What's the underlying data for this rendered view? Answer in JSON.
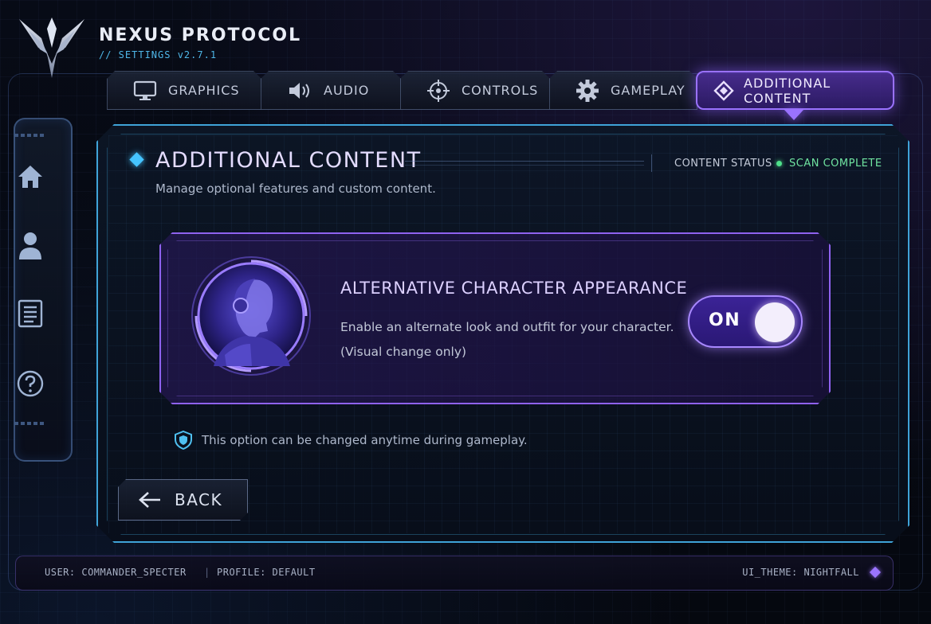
{
  "header": {
    "title": "NEXUS PROTOCOL",
    "subtitle": "// SETTINGS v2.7.1"
  },
  "tabs": [
    {
      "label": "GRAPHICS",
      "icon": "monitor-icon",
      "active": false
    },
    {
      "label": "AUDIO",
      "icon": "speaker-icon",
      "active": false
    },
    {
      "label": "CONTROLS",
      "icon": "crosshair-icon",
      "active": false
    },
    {
      "label": "GAMEPLAY",
      "icon": "gear-icon",
      "active": false
    },
    {
      "label": "ADDITIONAL CONTENT",
      "icon": "diamond-icon",
      "active": true
    }
  ],
  "sidebar": {
    "items": [
      {
        "icon": "home-icon"
      },
      {
        "icon": "user-icon"
      },
      {
        "icon": "list-icon"
      },
      {
        "icon": "help-icon"
      }
    ]
  },
  "section": {
    "title": "ADDITIONAL CONTENT",
    "description": "Manage optional features and custom content.",
    "status_label": "CONTENT STATUS",
    "status_value": "SCAN COMPLETE",
    "status_color": "#4ee08a"
  },
  "option": {
    "title": "ALTERNATIVE CHARACTER APPEARANCE",
    "description_line1": "Enable an alternate look and outfit for your character.",
    "description_line2": "(Visual change only)",
    "toggle_label": "ON",
    "toggle_on": true
  },
  "note": "This option can be changed anytime during gameplay.",
  "back_label": "BACK",
  "footer": {
    "user": "USER: COMMANDER_SPECTER",
    "separator": "|",
    "profile": "PROFILE: DEFAULT",
    "theme": "UI_THEME: NIGHTFALL"
  },
  "colors": {
    "accent_purple": "#9a72ff",
    "accent_cyan": "#3fa3d8",
    "status_green": "#4ee08a"
  }
}
